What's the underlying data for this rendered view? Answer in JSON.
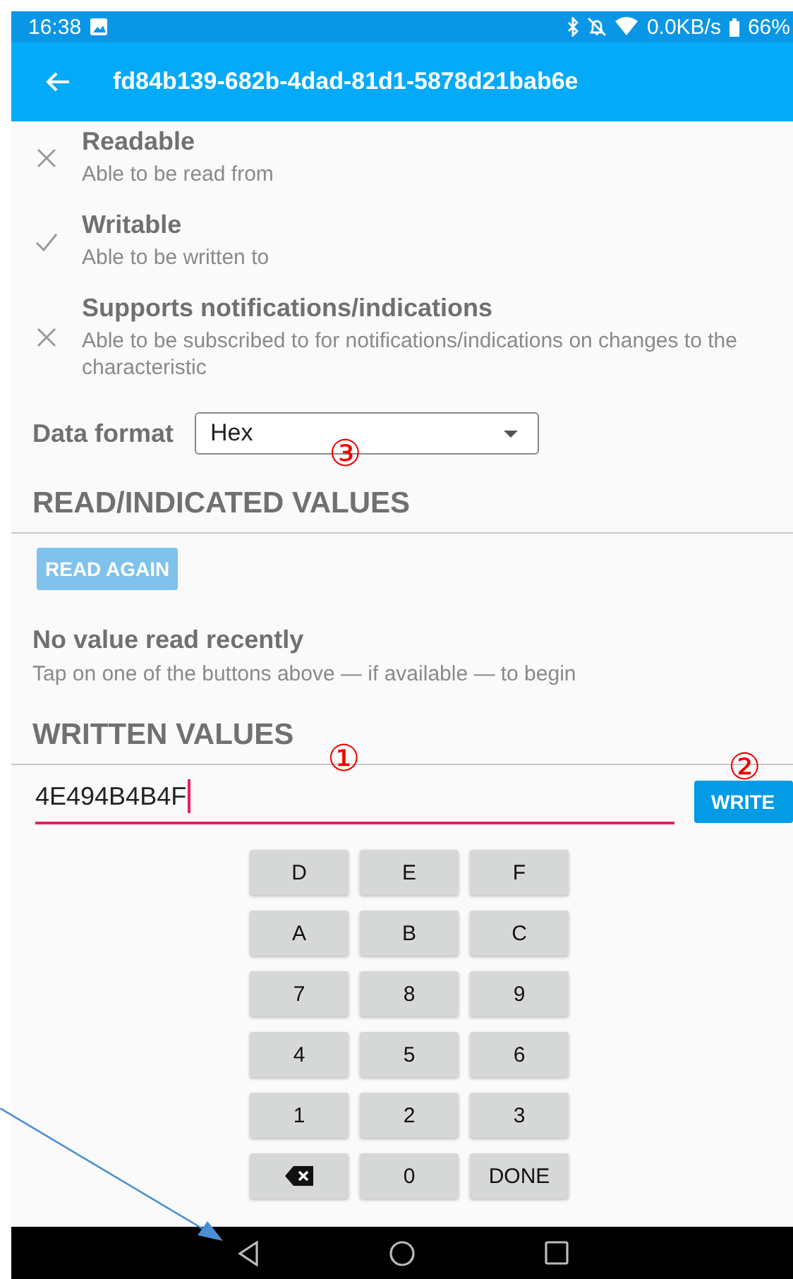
{
  "status_bar": {
    "time": "16:38",
    "speed": "0.0KB/s",
    "battery": "66%"
  },
  "app_bar": {
    "title": "fd84b139-682b-4dad-81d1-5878d21bab6e"
  },
  "properties": [
    {
      "title": "Readable",
      "description": "Able to be read from",
      "supported": false
    },
    {
      "title": "Writable",
      "description": "Able to be written to",
      "supported": true
    },
    {
      "title": "Supports notifications/indications",
      "description": "Able to be subscribed to for notifications/indications on changes to the characteristic",
      "supported": false
    }
  ],
  "data_format": {
    "label": "Data format",
    "value": "Hex",
    "annotation": "③"
  },
  "read_section": {
    "heading": "READ/INDICATED VALUES",
    "button": {
      "label": "READ AGAIN",
      "disabled": true
    },
    "empty_title": "No value read recently",
    "empty_text": "Tap on one of the buttons above — if available — to begin"
  },
  "write_section": {
    "heading": "WRITTEN VALUES",
    "value": "4E494B4B4F",
    "annotation": "①",
    "button": {
      "label": "WRITE",
      "disabled": false,
      "annotation": "②"
    }
  },
  "keypad": [
    {
      "kind": "char",
      "label": "D"
    },
    {
      "kind": "char",
      "label": "E"
    },
    {
      "kind": "char",
      "label": "F"
    },
    {
      "kind": "char",
      "label": "A"
    },
    {
      "kind": "char",
      "label": "B"
    },
    {
      "kind": "char",
      "label": "C"
    },
    {
      "kind": "char",
      "label": "7"
    },
    {
      "kind": "char",
      "label": "8"
    },
    {
      "kind": "char",
      "label": "9"
    },
    {
      "kind": "char",
      "label": "4"
    },
    {
      "kind": "char",
      "label": "5"
    },
    {
      "kind": "char",
      "label": "6"
    },
    {
      "kind": "char",
      "label": "1"
    },
    {
      "kind": "char",
      "label": "2"
    },
    {
      "kind": "char",
      "label": "3"
    },
    {
      "kind": "backspace"
    },
    {
      "kind": "char",
      "label": "0"
    },
    {
      "kind": "char",
      "label": "DONE"
    }
  ]
}
